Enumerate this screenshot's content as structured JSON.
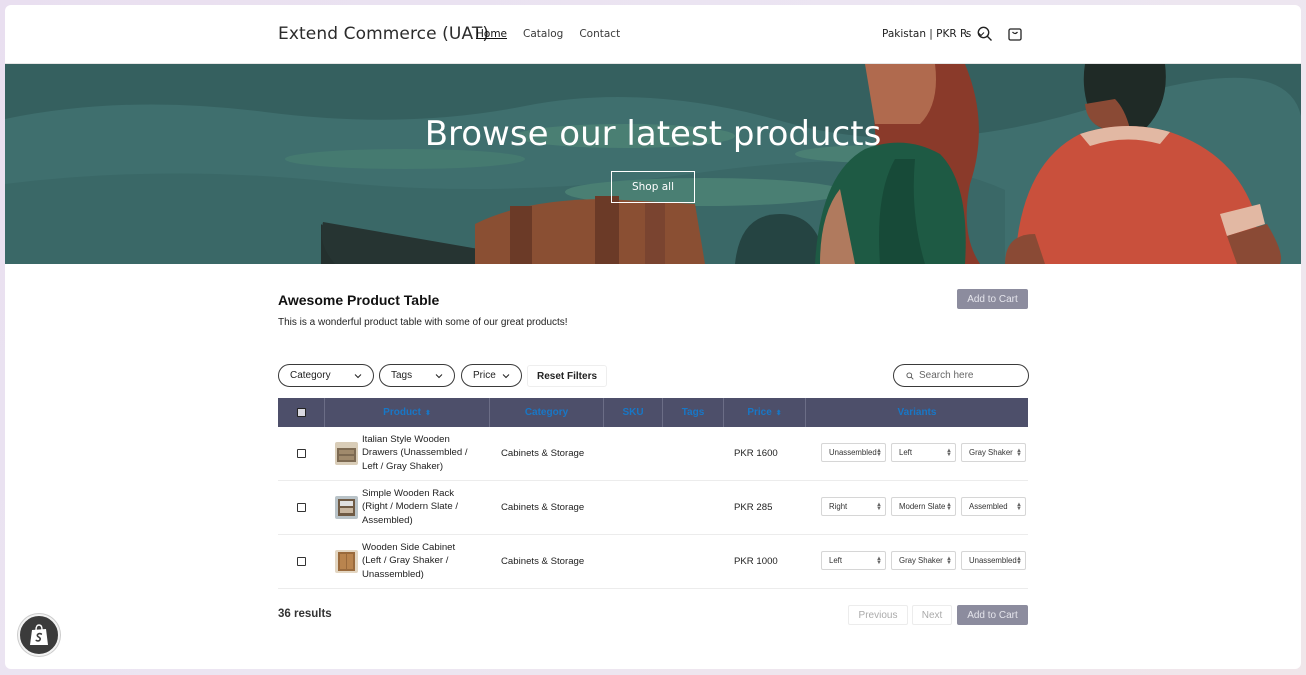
{
  "header": {
    "brand": "Extend Commerce (UAT)",
    "nav": [
      {
        "label": "Home",
        "active": true
      },
      {
        "label": "Catalog",
        "active": false
      },
      {
        "label": "Contact",
        "active": false
      }
    ],
    "locale": "Pakistan | PKR ₨",
    "icons": [
      "chevron-down-icon",
      "search-icon",
      "cart-icon"
    ]
  },
  "hero": {
    "title": "Browse our latest products",
    "button": "Shop all",
    "colors": {
      "water": "#3f6f6e",
      "shirt_green": "#1e5a44",
      "shirt_red": "#c9503c"
    }
  },
  "table": {
    "title": "Awesome Product Table",
    "description": "This is a wonderful product table with some of our great products!",
    "add_to_cart": "Add to Cart",
    "filters": [
      "Category",
      "Tags",
      "Price"
    ],
    "reset": "Reset Filters",
    "search_placeholder": "Search here",
    "columns": [
      "Product",
      "Category",
      "SKU",
      "Tags",
      "Price",
      "Variants"
    ],
    "rows": [
      {
        "name": "Italian Style Wooden Drawers (Unassembled / Left / Gray Shaker)",
        "category": "Cabinets & Storage",
        "sku": "",
        "tags": "",
        "price": "PKR 1600",
        "variants": [
          "Unassembled",
          "Left",
          "Gray Shaker"
        ]
      },
      {
        "name": "Simple Wooden Rack (Right / Modern Slate / Assembled)",
        "category": "Cabinets & Storage",
        "sku": "",
        "tags": "",
        "price": "PKR 285",
        "variants": [
          "Right",
          "Modern Slate",
          "Assembled"
        ]
      },
      {
        "name": "Wooden Side Cabinet (Left / Gray Shaker / Unassembled)",
        "category": "Cabinets & Storage",
        "sku": "",
        "tags": "",
        "price": "PKR 1000",
        "variants": [
          "Left",
          "Gray Shaker",
          "Unassembled"
        ]
      }
    ],
    "results": "36 results",
    "previous": "Previous",
    "next": "Next"
  },
  "accent": {
    "table_header_bg": "#4d4f6a",
    "header_text": "#1877c6",
    "cart_button": "#8c8c9e"
  }
}
